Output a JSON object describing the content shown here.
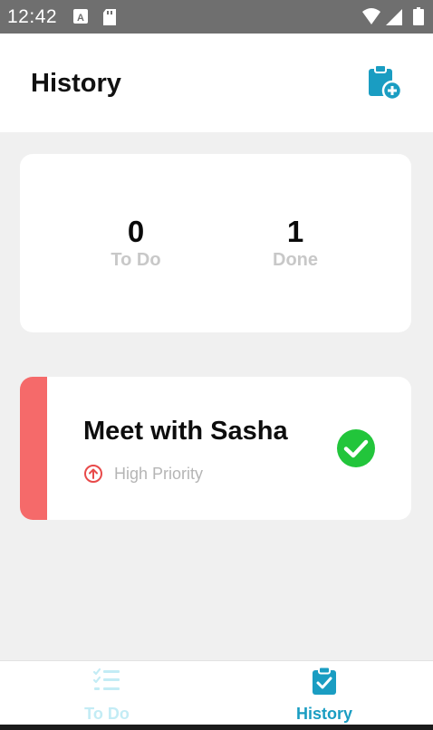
{
  "status_bar": {
    "time": "12:42"
  },
  "header": {
    "title": "History"
  },
  "summary": {
    "todo_count": "0",
    "todo_label": "To Do",
    "done_count": "1",
    "done_label": "Done"
  },
  "tasks": [
    {
      "title": "Meet with Sasha",
      "priority": "High Priority",
      "status": "done"
    }
  ],
  "bottom_nav": {
    "items": [
      {
        "label": "To Do",
        "active": false
      },
      {
        "label": "History",
        "active": true
      }
    ]
  },
  "colors": {
    "accent": "#1a9dc2",
    "high_priority": "#f56a6a",
    "done_check": "#22c53b",
    "status_bar": "#6f6f6f"
  },
  "icons": {
    "add_task": "clipboard-plus-icon",
    "priority": "arrow-up-circle-icon",
    "done": "check-circle-icon",
    "nav_todo": "checklist-icon",
    "nav_history": "clipboard-check-icon"
  }
}
